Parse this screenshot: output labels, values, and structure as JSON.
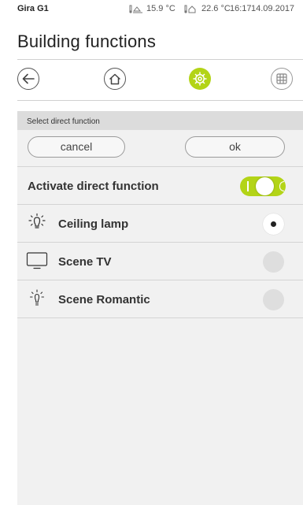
{
  "status_bar": {
    "device": "Gira G1",
    "temp_outdoor": "15.9 °C",
    "temp_indoor": "22.6 °C",
    "time": "16:17",
    "date": "14.09.2017"
  },
  "page": {
    "title": "Building functions"
  },
  "nav": {
    "back_icon": "arrow-left-icon",
    "home_icon": "house-icon",
    "functions_icon": "gear-icon",
    "grid_icon": "grid-icon",
    "active_color": "#b3d417"
  },
  "panel": {
    "header": "Select direct function",
    "cancel_label": "cancel",
    "ok_label": "ok",
    "activate_label": "Activate direct function",
    "activate_on": true,
    "items": [
      {
        "label": "Ceiling lamp",
        "icon": "ceiling-lamp-icon",
        "selected": true
      },
      {
        "label": "Scene TV",
        "icon": "tv-icon",
        "selected": false
      },
      {
        "label": "Scene Romantic",
        "icon": "dim-lamp-icon",
        "selected": false
      }
    ]
  }
}
